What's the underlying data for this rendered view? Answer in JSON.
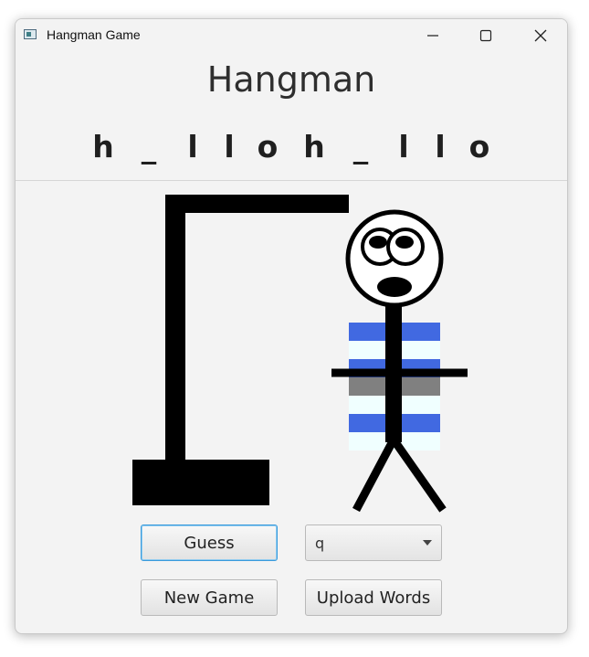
{
  "window": {
    "title": "Hangman Game"
  },
  "game": {
    "heading": "Hangman",
    "word": [
      "h",
      "_",
      "l",
      "l",
      "o",
      "h",
      "_",
      "l",
      "l",
      "o"
    ]
  },
  "controls": {
    "guess_label": "Guess",
    "letter_value": "q",
    "new_game_label": "New Game",
    "upload_label": "Upload Words"
  },
  "figure": {
    "body_stripes": [
      "#4169e1",
      "#f0ffff",
      "#4169e1",
      "#808080",
      "#f0ffff",
      "#4169e1",
      "#f0ffff"
    ]
  },
  "icons": [
    "app-icon",
    "minimize-icon",
    "maximize-icon",
    "close-icon",
    "chevron-down-icon"
  ]
}
